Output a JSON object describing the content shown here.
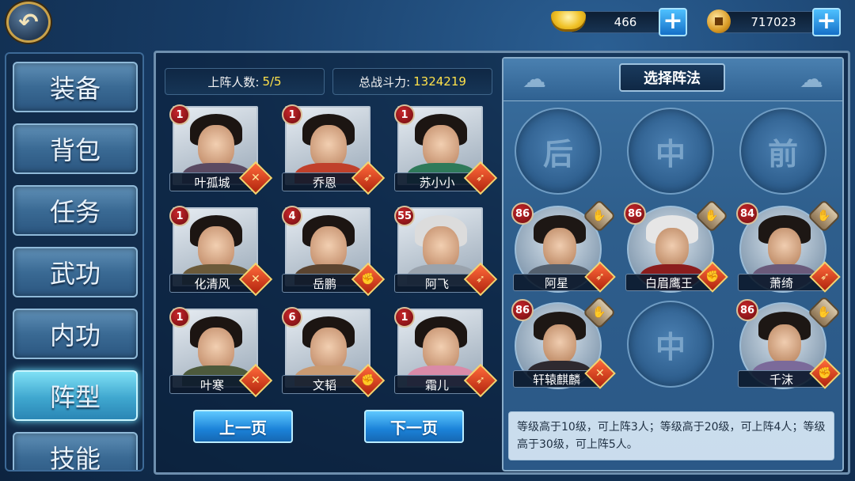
{
  "currency": {
    "gold_value": "466",
    "coin_value": "717023",
    "gold_icon": "gold-ingot-icon",
    "coin_icon": "copper-coin-icon",
    "plus_label": "+"
  },
  "back_icon": "↶",
  "menu": {
    "items": [
      {
        "label": "装备"
      },
      {
        "label": "背包"
      },
      {
        "label": "任务"
      },
      {
        "label": "武功"
      },
      {
        "label": "内功"
      },
      {
        "label": "阵型"
      },
      {
        "label": "技能"
      }
    ],
    "active_index": 5
  },
  "stats": {
    "deployed_label": "上阵人数:",
    "deployed_value": "5/5",
    "power_label": "总战斗力:",
    "power_value": "1324219"
  },
  "heroes": [
    {
      "name": "叶孤城",
      "level": "1",
      "type": "sword"
    },
    {
      "name": "乔恩",
      "level": "1",
      "type": "spear"
    },
    {
      "name": "苏小小",
      "level": "1",
      "type": "spear"
    },
    {
      "name": "化清风",
      "level": "1",
      "type": "sword"
    },
    {
      "name": "岳鹏",
      "level": "4",
      "type": "fist"
    },
    {
      "name": "阿飞",
      "level": "55",
      "type": "spear"
    },
    {
      "name": "叶寒",
      "level": "1",
      "type": "sword"
    },
    {
      "name": "文韬",
      "level": "6",
      "type": "fist"
    },
    {
      "name": "霜儿",
      "level": "1",
      "type": "spear"
    }
  ],
  "pagination": {
    "prev_label": "上一页",
    "next_label": "下一页"
  },
  "formation": {
    "title": "选择阵法",
    "row_labels": {
      "back": "后",
      "middle": "中",
      "front": "前"
    },
    "empty_slot_label": "中",
    "members": [
      {
        "name": "阿星",
        "level": "86",
        "type": "spear"
      },
      {
        "name": "白眉鹰王",
        "level": "86",
        "type": "fist"
      },
      {
        "name": "萧绮",
        "level": "84",
        "type": "spear"
      },
      {
        "name": "轩辕麒麟",
        "level": "86",
        "type": "sword"
      },
      {
        "name": "千沫",
        "level": "86",
        "type": "fist"
      }
    ],
    "rule_text": "等级高于10级，可上阵3人；等级高于20级，可上阵4人；等级高于30级，可上阵5人。"
  },
  "colors": {
    "level_badge": "#c8262b",
    "power_value": "#ffe24a",
    "active_menu": "#3fa7cf",
    "button_blue": "#1b82d8"
  }
}
